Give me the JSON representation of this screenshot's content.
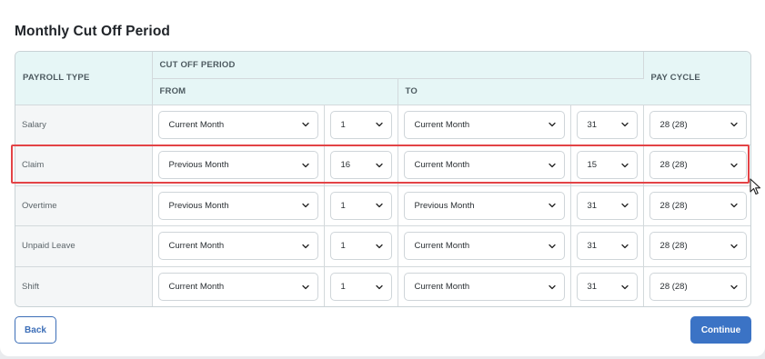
{
  "page": {
    "title": "Monthly Cut Off Period"
  },
  "headers": {
    "payroll_type": "PAYROLL TYPE",
    "cut_off_period": "CUT OFF PERIOD",
    "from": "FROM",
    "to": "TO",
    "pay_cycle": "PAY CYCLE"
  },
  "rows": [
    {
      "type": "Salary",
      "from_month": "Current Month",
      "from_day": "1",
      "to_month": "Current Month",
      "to_day": "31",
      "pay_cycle": "28 (28)"
    },
    {
      "type": "Claim",
      "from_month": "Previous Month",
      "from_day": "16",
      "to_month": "Current Month",
      "to_day": "15",
      "pay_cycle": "28 (28)"
    },
    {
      "type": "Overtime",
      "from_month": "Previous Month",
      "from_day": "1",
      "to_month": "Previous Month",
      "to_day": "31",
      "pay_cycle": "28 (28)"
    },
    {
      "type": "Unpaid Leave",
      "from_month": "Current Month",
      "from_day": "1",
      "to_month": "Current Month",
      "to_day": "31",
      "pay_cycle": "28 (28)"
    },
    {
      "type": "Shift",
      "from_month": "Current Month",
      "from_day": "1",
      "to_month": "Current Month",
      "to_day": "31",
      "pay_cycle": "28 (28)"
    }
  ],
  "buttons": {
    "back": "Back",
    "continue": "Continue"
  },
  "colors": {
    "accent": "#3b73c5",
    "header_bg": "#e6f6f6",
    "highlight": "#e34346"
  },
  "icons": {
    "dropdown": "chevron-down-icon",
    "cursor": "mouse-pointer-icon"
  }
}
